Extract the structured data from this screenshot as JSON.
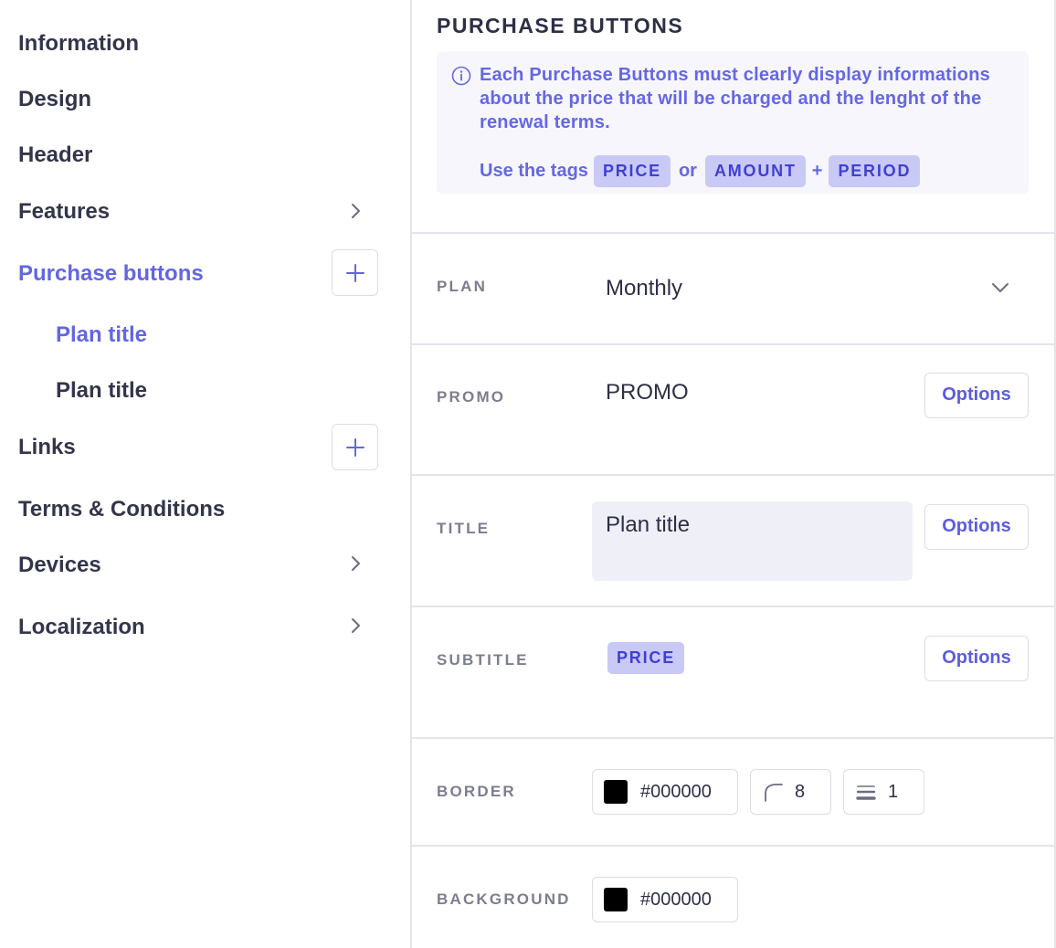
{
  "sidebar": {
    "items": [
      {
        "label": "Information"
      },
      {
        "label": "Design"
      },
      {
        "label": "Header"
      },
      {
        "label": "Features"
      },
      {
        "label": "Purchase buttons"
      },
      {
        "label": "Links"
      },
      {
        "label": "Terms & Conditions"
      },
      {
        "label": "Devices"
      },
      {
        "label": "Localization"
      }
    ],
    "sub_items": [
      {
        "label": "Plan title"
      },
      {
        "label": "Plan title"
      }
    ]
  },
  "panel": {
    "title": "PURCHASE BUTTONS",
    "info_text": "Each Purchase Buttons must clearly display informations about the price that will be charged and the lenght of the renewal terms.",
    "tags_prefix": "Use the tags",
    "tag_price": "PRICE",
    "tag_or": "or",
    "tag_amount": "AMOUNT",
    "tag_plus": "+",
    "tag_period": "PERIOD"
  },
  "fields": {
    "plan": {
      "label": "PLAN",
      "value": "Monthly"
    },
    "promo": {
      "label": "PROMO",
      "value": "PROMO",
      "options": "Options"
    },
    "title": {
      "label": "TITLE",
      "value": "Plan title",
      "options": "Options"
    },
    "subtitle": {
      "label": "SUBTITLE",
      "tag": "PRICE",
      "options": "Options"
    },
    "border": {
      "label": "BORDER",
      "color": "#000000",
      "radius": "8",
      "width": "1"
    },
    "background": {
      "label": "BACKGROUND",
      "color": "#000000"
    }
  },
  "colors": {
    "accent": "#6366e1",
    "swatch_border": "#000000",
    "swatch_background": "#000000"
  },
  "icons": {
    "chevron_right": "chevron-right-icon",
    "plus": "plus-icon",
    "info": "info-icon",
    "chevron_down": "chevron-down-icon",
    "corner_radius": "corner-radius-icon",
    "border_width": "border-width-icon"
  }
}
